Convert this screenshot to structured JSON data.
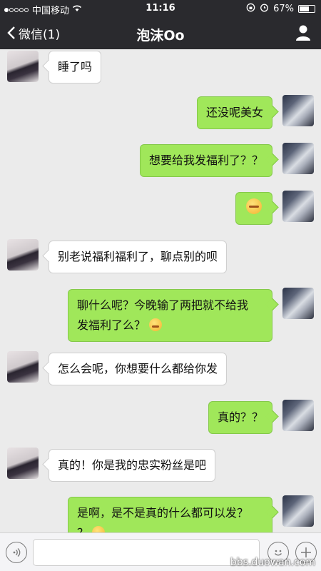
{
  "status": {
    "carrier": "中国移动",
    "time": "11:16",
    "battery": "67%",
    "battery_level": 0.67,
    "signal_dots_full": 1,
    "signal_dots_total": 5
  },
  "header": {
    "back_label": "微信(1)",
    "title": "泡沫Oo",
    "profile_icon": "person-icon"
  },
  "messages": [
    {
      "side": "left",
      "text": "睡了吗",
      "emoji": false
    },
    {
      "side": "right",
      "text": "还没呢美女",
      "emoji": false
    },
    {
      "side": "right",
      "text": "想要给我发福利了？？",
      "emoji": false
    },
    {
      "side": "right",
      "text": "",
      "emoji": true
    },
    {
      "side": "left",
      "text": "别老说福利福利了，聊点别的呗",
      "emoji": false
    },
    {
      "side": "right",
      "line1": "聊什么呢？今晚输了两把就不给我",
      "line2": "发福利了么？",
      "emoji": true
    },
    {
      "side": "left",
      "text": "怎么会呢，你想要什么都给你发",
      "emoji": false
    },
    {
      "side": "right",
      "text": "真的？？",
      "emoji": false
    },
    {
      "side": "left",
      "text": "真的！你是我的忠实粉丝是吧",
      "emoji": false
    },
    {
      "side": "right",
      "line1": "是啊，是不是真的什么都可以发？",
      "line2": "？",
      "emoji": true
    }
  ],
  "input": {
    "placeholder": "",
    "voice_icon": "voice-icon",
    "emoji_icon": "emoji-icon",
    "plus_icon": "plus-icon"
  },
  "watermark": "bbs.duowan.com",
  "colors": {
    "bar": "#2a2a2e",
    "background": "#ebebeb",
    "bubble_right": "#a0e75a",
    "bubble_left": "#ffffff"
  }
}
